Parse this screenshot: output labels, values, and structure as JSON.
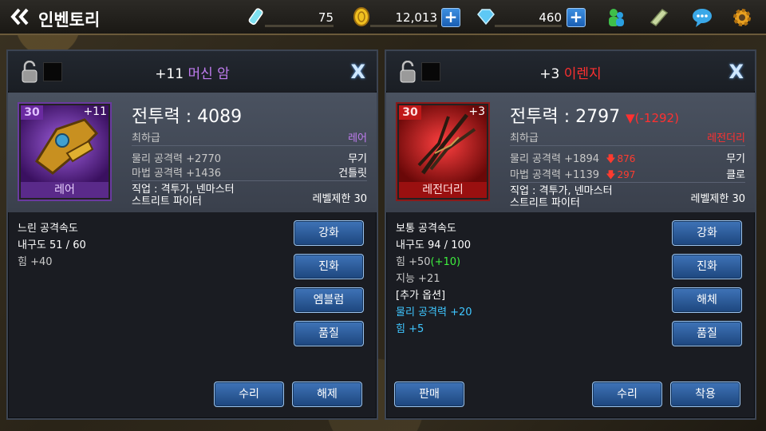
{
  "header": {
    "title": "인벤토리",
    "energy": "75",
    "gold": "12,013",
    "gems": "460"
  },
  "left_panel": {
    "enhance": "+11",
    "name": "머신 암",
    "name_color": "#c07cf0",
    "item_level": "30",
    "item_plus": "+11",
    "grade_label": "레어",
    "combat_power": "전투력 : 4089",
    "tier": "최하급",
    "grade": "레어",
    "stat1": "물리 공격력 +2770",
    "stat2": "마법 공격력 +1436",
    "type1": "무기",
    "type2": "건틀릿",
    "job_line1": "직업 : 격투가, 넨마스터",
    "job_line2": "스트리트 파이터",
    "level_limit": "레벨제한 30",
    "stats": [
      "느린 공격속도",
      "내구도 51 / 60",
      "힘 +40"
    ],
    "buttons": [
      "강화",
      "진화",
      "엠블럼",
      "품질"
    ],
    "bottom_buttons": [
      "수리",
      "해제"
    ]
  },
  "right_panel": {
    "enhance": "+3",
    "name": "이렌지",
    "name_color": "#ff3030",
    "item_level": "30",
    "item_plus": "+3",
    "grade_label": "레전더리",
    "combat_power": "전투력 : 2797",
    "cp_diff": "▼(-1292)",
    "tier": "최하급",
    "grade": "레전더리",
    "stat1": "물리 공격력 +1894",
    "stat1_diff": "876",
    "stat2": "마법 공격력 +1139",
    "stat2_diff": "297",
    "type1": "무기",
    "type2": "클로",
    "job_line1": "직업 : 격투가, 넨마스터",
    "job_line2": "스트리트 파이터",
    "level_limit": "레벨제한 30",
    "stats": {
      "speed": "보통 공격속도",
      "durability": "내구도 94 / 100",
      "str": "힘 +50",
      "str_bonus": "(+10)",
      "int": "지능 +21",
      "extra_header": "[추가 옵션]",
      "extra1": "물리 공격력 +20",
      "extra2": "힘 +5"
    },
    "buttons": [
      "강화",
      "진화",
      "해체",
      "품질"
    ],
    "bottom_buttons": [
      "판매",
      "수리",
      "착용"
    ]
  }
}
